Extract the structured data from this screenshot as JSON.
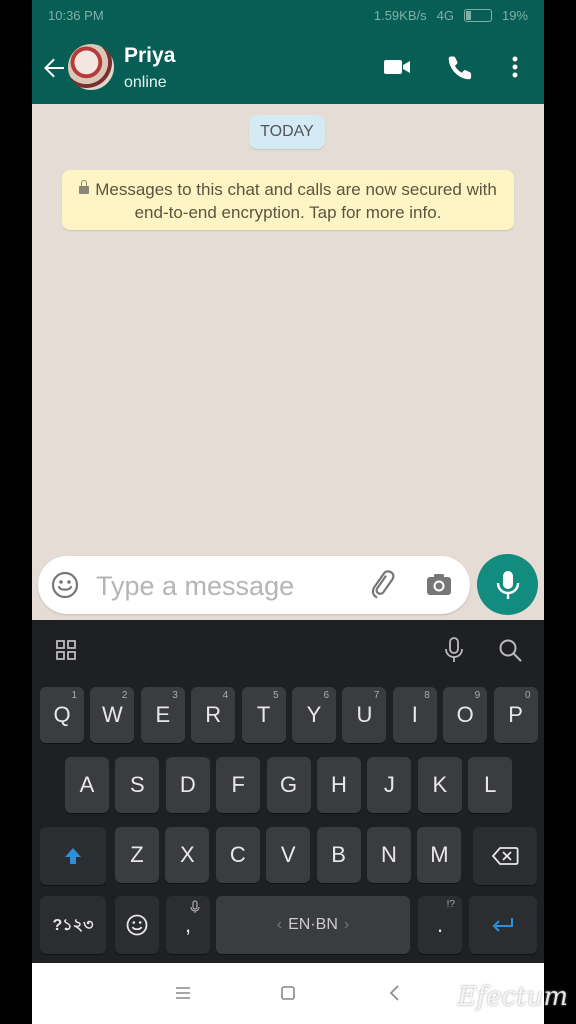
{
  "status_bar": {
    "time": "10:36 PM",
    "network_speed": "1.59KB/s",
    "signal": "4G",
    "battery": "19%"
  },
  "contact": {
    "name": "Priya",
    "presence": "online"
  },
  "chat": {
    "date_chip": "TODAY",
    "encryption_notice": "Messages to this chat and calls are now secured with end-to-end encryption. Tap for more info."
  },
  "composer": {
    "placeholder": "Type a message"
  },
  "keyboard": {
    "row1": [
      {
        "k": "Q",
        "h": "1"
      },
      {
        "k": "W",
        "h": "2"
      },
      {
        "k": "E",
        "h": "3"
      },
      {
        "k": "R",
        "h": "4"
      },
      {
        "k": "T",
        "h": "5"
      },
      {
        "k": "Y",
        "h": "6"
      },
      {
        "k": "U",
        "h": "7"
      },
      {
        "k": "I",
        "h": "8"
      },
      {
        "k": "O",
        "h": "9"
      },
      {
        "k": "P",
        "h": "0"
      }
    ],
    "row2": [
      "A",
      "S",
      "D",
      "F",
      "G",
      "H",
      "J",
      "K",
      "L"
    ],
    "row3": [
      "Z",
      "X",
      "C",
      "V",
      "B",
      "N",
      "M"
    ],
    "symbols_label": "?১২৩",
    "comma": ",",
    "space_label": "EN·BN",
    "period": ".",
    "period_hint": "!?"
  },
  "watermark": "Efectum",
  "colors": {
    "header": "#075e54",
    "accent": "#128c7e",
    "notice_bg": "#fff5c4",
    "date_bg": "#d4eaf4",
    "chat_bg": "#e5ddd5"
  }
}
